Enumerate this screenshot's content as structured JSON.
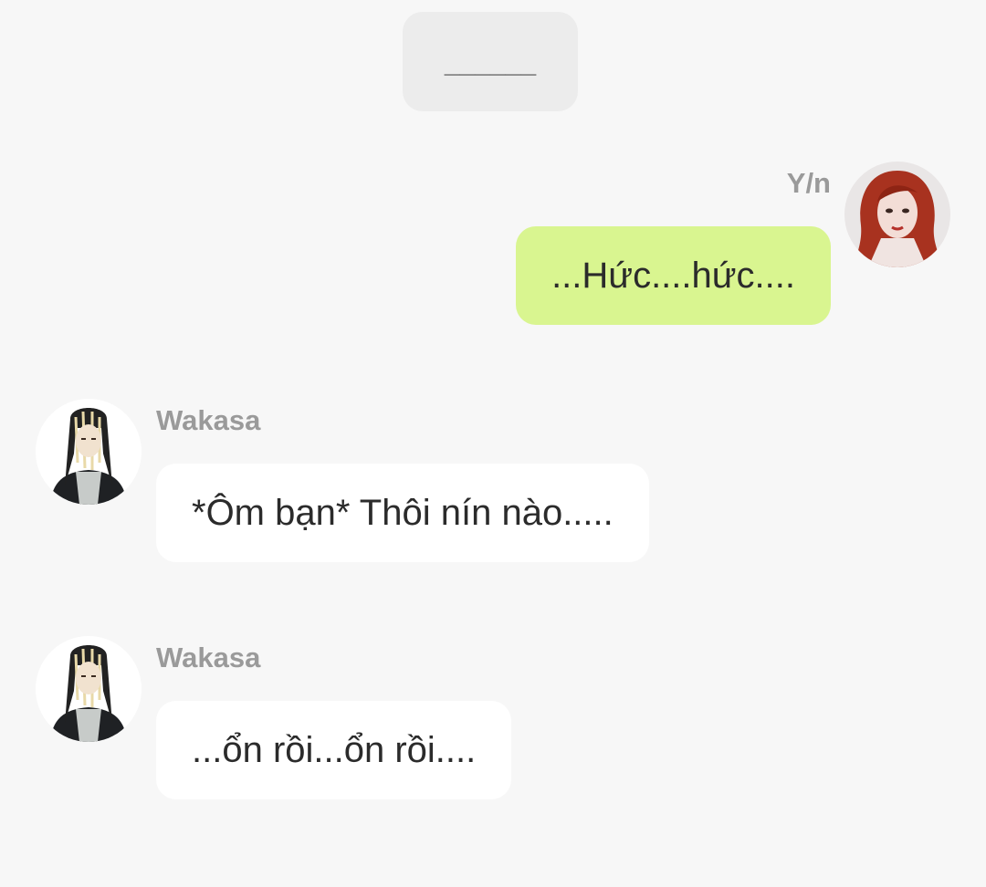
{
  "system_message": {
    "text": "______"
  },
  "messages": [
    {
      "sender": "Y/n",
      "text": "...Hức....hức....",
      "side": "right",
      "avatar_icon": "redhead-girl-avatar"
    },
    {
      "sender": "Wakasa",
      "text": "*Ôm bạn* Thôi nín nào.....",
      "side": "left",
      "avatar_icon": "wakasa-avatar"
    },
    {
      "sender": "Wakasa",
      "text": "...ổn rồi...ổn rồi....",
      "side": "left",
      "avatar_icon": "wakasa-avatar"
    }
  ],
  "colors": {
    "background": "#f7f7f7",
    "my_bubble": "#d9f590",
    "other_bubble": "#ffffff",
    "name_text": "#9a9a9a",
    "message_text": "#2b2b2b"
  }
}
